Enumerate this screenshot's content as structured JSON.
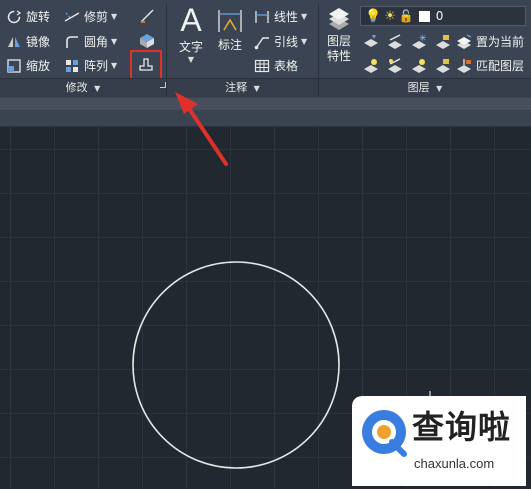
{
  "ribbon": {
    "modify": {
      "rotate": "旋转",
      "mirror": "镜像",
      "scale": "缩放",
      "trim": "修剪",
      "fillet": "圆角",
      "array": "阵列",
      "panel_title": "修改"
    },
    "annotation": {
      "text": "文字",
      "dimension": "标注",
      "linetype": "线性",
      "leader": "引线",
      "table": "表格",
      "panel_title": "注释"
    },
    "layers": {
      "layer_properties_line1": "图层",
      "layer_properties_line2": "特性",
      "current_layer": "0",
      "set_current": "置为当前",
      "match_layer": "匹配图层",
      "panel_title": "图层"
    }
  },
  "watermark": {
    "brand": "查询啦",
    "url": "chaxunla.com"
  },
  "colors": {
    "highlight": "#e0302c",
    "canvas": "#212830",
    "ribbon": "#3b4452"
  }
}
